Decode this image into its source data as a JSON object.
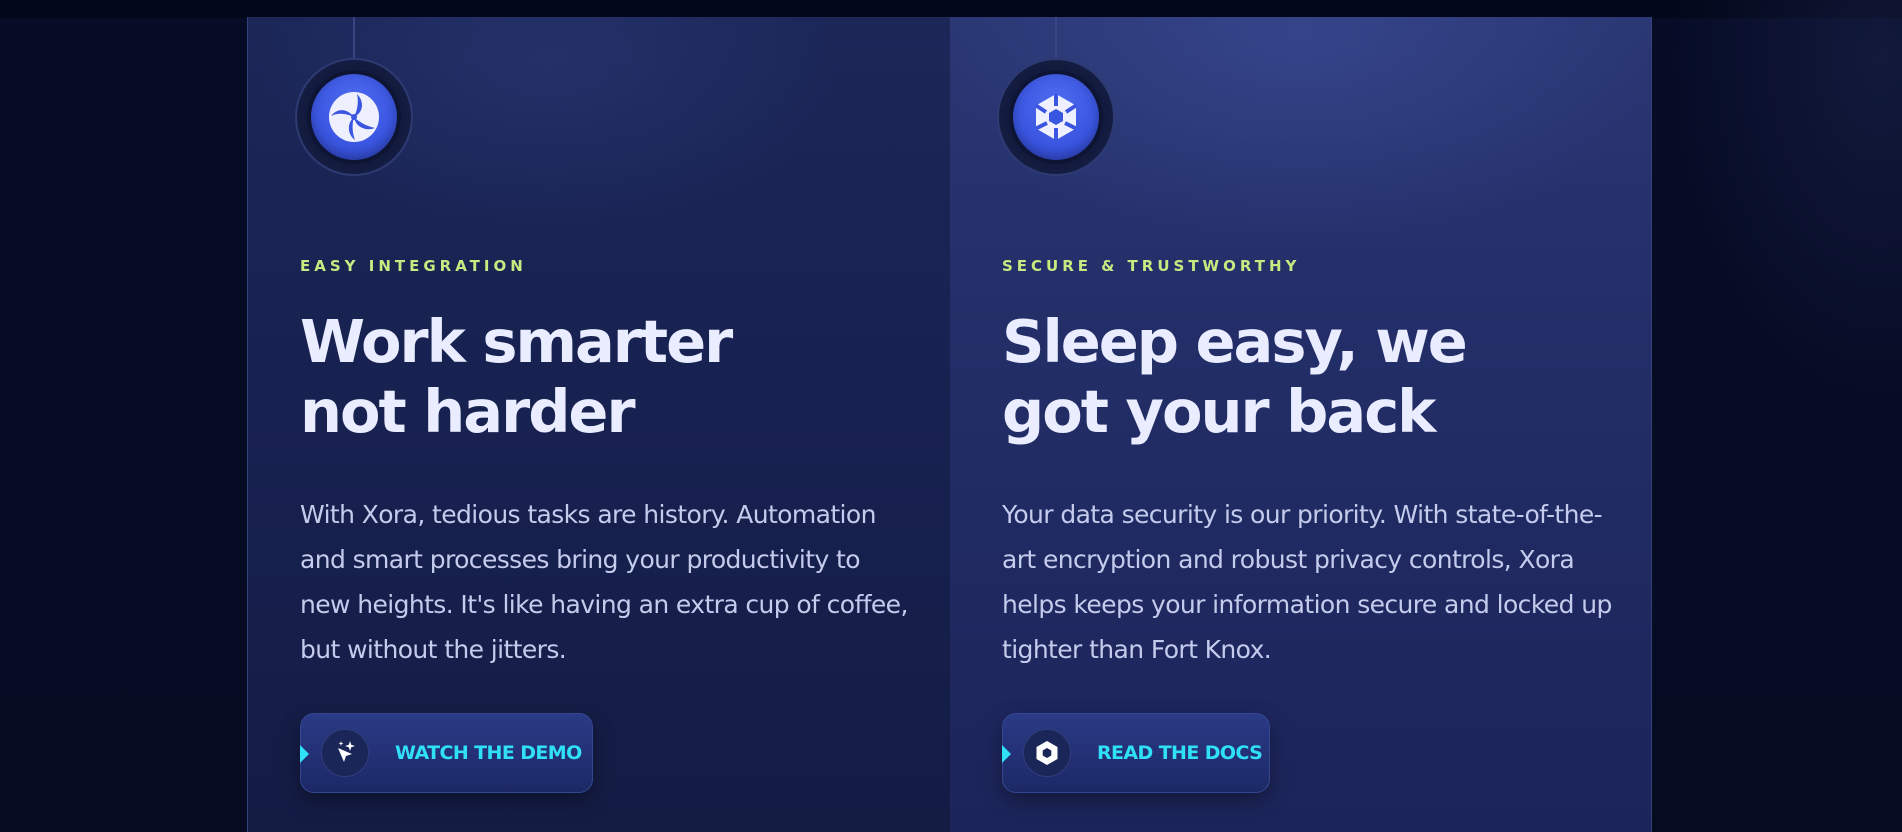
{
  "features": [
    {
      "eyebrow": "EASY INTEGRATION",
      "heading_line1": "Work smarter",
      "heading_line2": "not harder",
      "body": "With Xora, tedious tasks are history. Automation and smart processes bring your productivity to new heights. It's like having an extra cup of coffee, but without the jitters.",
      "icon": "swirl-logo-icon",
      "button": {
        "label": "WATCH THE DEMO",
        "icon": "cursor-sparkle-icon"
      }
    },
    {
      "eyebrow": "SECURE & TRUSTWORTHY",
      "heading_line1": "Sleep easy, we",
      "heading_line2": "got your back",
      "body": "Your data security is our priority. With state-of-the-art encryption and robust privacy controls, Xora helps keeps your information secure and locked up tighter than Fort Knox.",
      "icon": "hexagon-shield-icon",
      "button": {
        "label": "READ THE DOCS",
        "icon": "hexagon-docs-icon"
      }
    }
  ],
  "colors": {
    "eyebrow": "#c8ea80",
    "heading": "#eaedff",
    "body": "#c4cbec",
    "button_accent": "#2fe0f7",
    "icon_blue": "#3a55e0"
  }
}
